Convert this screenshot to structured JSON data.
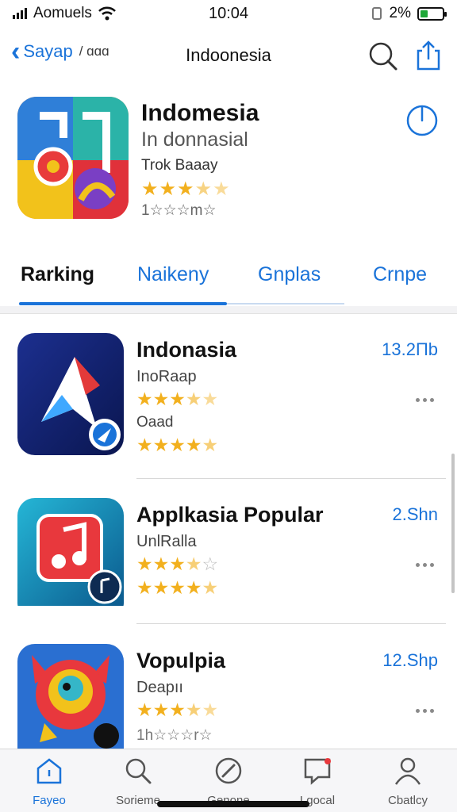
{
  "status_bar": {
    "carrier": "Aomuels",
    "time": "10:04",
    "battery": "2%",
    "battery_level": 0.35,
    "icons": [
      "signal-icon",
      "wifi-icon",
      "battery-icon"
    ]
  },
  "nav": {
    "back_label": "Sayap",
    "back_sub": "/ ɑɑɑ",
    "title": "Indoonesia",
    "icons": [
      "back-chevron-icon",
      "search-icon",
      "share-icon"
    ]
  },
  "hero": {
    "title": "Indomesia",
    "subtitle": "In donnasial",
    "developer": "Trok Baaay",
    "stars": "★★★★★",
    "rating": 3.5,
    "rating_count": "1☆☆☆m☆",
    "icon": "indonesia-app-icon"
  },
  "tabs": [
    {
      "label": "Rarking",
      "active": true
    },
    {
      "label": "Naikeny",
      "active": false
    },
    {
      "label": "Gnplas",
      "active": false
    },
    {
      "label": "Crnpe",
      "active": false
    }
  ],
  "apps": [
    {
      "name": "Indonasia",
      "subtitle": "InoRaap",
      "stars_a": "★★★★☆",
      "rating_a": 3.5,
      "line3": "Oaad",
      "stars_b": "★★★★☆",
      "rating_b": 4.5,
      "size": "13.2Пb",
      "icon": "blue-arrow-app-icon"
    },
    {
      "name": "Applkasia Popular",
      "subtitle": "UnlRalla",
      "stars_a": "★★★★☆",
      "rating_a": 3.5,
      "line3": "",
      "stars_b": "★★★★☆",
      "rating_b": 4.5,
      "size": "2.Shn",
      "icon": "music-app-icon"
    },
    {
      "name": "Vopulpia",
      "subtitle": "Deapıı",
      "stars_a": "★★★★☆",
      "rating_a": 3.5,
      "line3": "",
      "stars_b": "1h☆☆☆r☆",
      "rating_b": null,
      "size": "12.Shp",
      "icon": "robot-game-app-icon"
    }
  ],
  "tabbar": [
    {
      "label": "Fayeo",
      "icon": "home-icon",
      "active": true
    },
    {
      "label": "Sorieme",
      "icon": "search-magnifier-icon",
      "active": false
    },
    {
      "label": "Genone",
      "icon": "compass-icon",
      "active": false
    },
    {
      "label": "Lgocal",
      "icon": "chat-icon",
      "active": false
    },
    {
      "label": "Cbatlcy",
      "icon": "profile-icon",
      "active": false
    }
  ],
  "colors": {
    "accent": "#1a73d9",
    "star": "#f2b01e",
    "battery": "#1fa838"
  }
}
